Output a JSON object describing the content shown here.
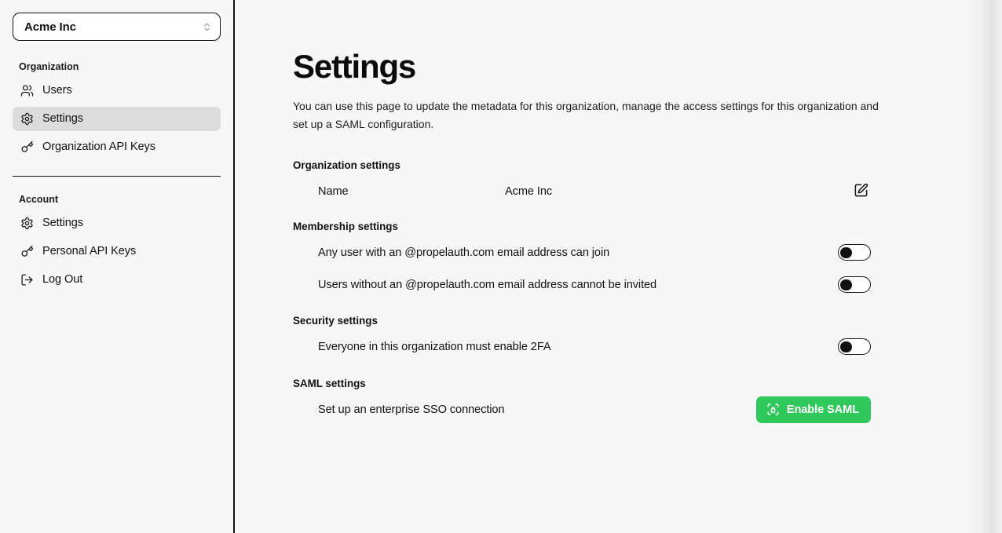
{
  "sidebar": {
    "org_selector": {
      "value": "Acme Inc",
      "icon": "chevrons-up-down-icon"
    },
    "groups": [
      {
        "title": "Organization",
        "items": [
          {
            "label": "Users",
            "icon": "users-icon",
            "active": false
          },
          {
            "label": "Settings",
            "icon": "gear-icon",
            "active": true
          },
          {
            "label": "Organization API Keys",
            "icon": "key-icon",
            "active": false
          }
        ]
      },
      {
        "title": "Account",
        "items": [
          {
            "label": "Settings",
            "icon": "gear-icon",
            "active": false
          },
          {
            "label": "Personal API Keys",
            "icon": "key-icon",
            "active": false
          },
          {
            "label": "Log Out",
            "icon": "log-out-icon",
            "active": false
          }
        ]
      }
    ]
  },
  "main": {
    "title": "Settings",
    "description": "You can use this page to update the metadata for this organization, manage the access settings for this organization and set up a SAML configuration.",
    "organization_settings": {
      "title": "Organization settings",
      "name_label": "Name",
      "name_value": "Acme Inc",
      "edit_icon": "edit-square-pen-icon"
    },
    "membership_settings": {
      "title": "Membership settings",
      "rows": [
        {
          "label": "Any user with an @propelauth.com email address can join",
          "toggle_state": "off"
        },
        {
          "label": "Users without an @propelauth.com email address cannot be invited",
          "toggle_state": "off"
        }
      ]
    },
    "security_settings": {
      "title": "Security settings",
      "rows": [
        {
          "label": "Everyone in this organization must enable 2FA",
          "toggle_state": "off"
        }
      ]
    },
    "saml_settings": {
      "title": "SAML settings",
      "label": "Set up an enterprise SSO connection",
      "button_label": "Enable SAML",
      "button_icon": "scan-face-lock-icon"
    }
  },
  "colors": {
    "accent_green": "#2ec95a",
    "page_background": "#f7f7f7",
    "active_nav_background": "#dcdcdc",
    "text_primary": "#111111"
  }
}
